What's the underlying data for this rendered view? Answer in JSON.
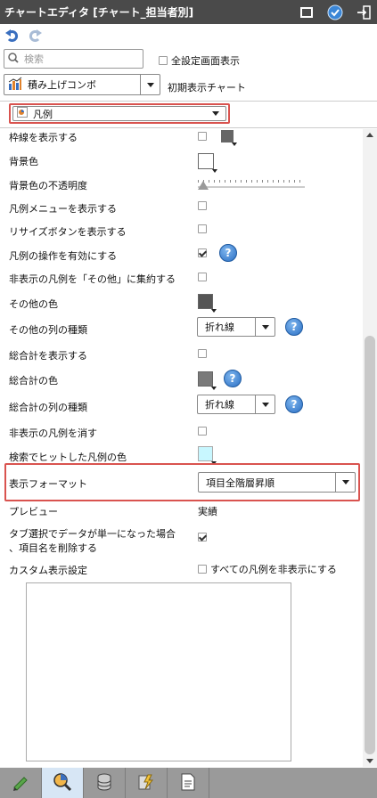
{
  "window": {
    "title": "チャートエディタ [チャート_担当者別]"
  },
  "search": {
    "placeholder": "検索"
  },
  "full_settings": {
    "label": "全設定画面表示",
    "checked": false
  },
  "chart_type": {
    "value": "積み上げコンボ",
    "initial_label": "初期表示チャート"
  },
  "category": {
    "value": "凡例"
  },
  "rows": {
    "show_border": "枠線を表示する",
    "bg_color": "背景色",
    "bg_opacity": "背景色の不透明度",
    "show_legend_menu": "凡例メニューを表示する",
    "show_resize_button": "リサイズボタンを表示する",
    "enable_legend_ops": "凡例の操作を有効にする",
    "aggregate_hidden": "非表示の凡例を「その他」に集約する",
    "other_color": "その他の色",
    "other_series_type": "その他の列の種類",
    "show_total": "総合計を表示する",
    "total_color": "総合計の色",
    "total_series_type": "総合計の列の種類",
    "clear_hidden": "非表示の凡例を消す",
    "search_hit_color": "検索でヒットした凡例の色",
    "display_format": "表示フォーマット",
    "preview": "プレビュー",
    "tab_select_line1": "タブ選択でデータが単一になった場合",
    "tab_select_line2": "、項目名を削除する",
    "custom_display": "カスタム表示設定"
  },
  "values": {
    "series_type_option": "折れ線",
    "total_series_type_option": "折れ線",
    "display_format_value": "項目全階層昇順",
    "preview_value": "実績",
    "hide_all_legends_label": "すべての凡例を非表示にする"
  },
  "colors": {
    "titlebar": "#4a4a4a",
    "border_swatch": "#666666",
    "other_color": "#555555",
    "total_color": "#7a7a7a",
    "search_hit_color": "#c8f7ff",
    "highlight_red": "#d9534f"
  }
}
